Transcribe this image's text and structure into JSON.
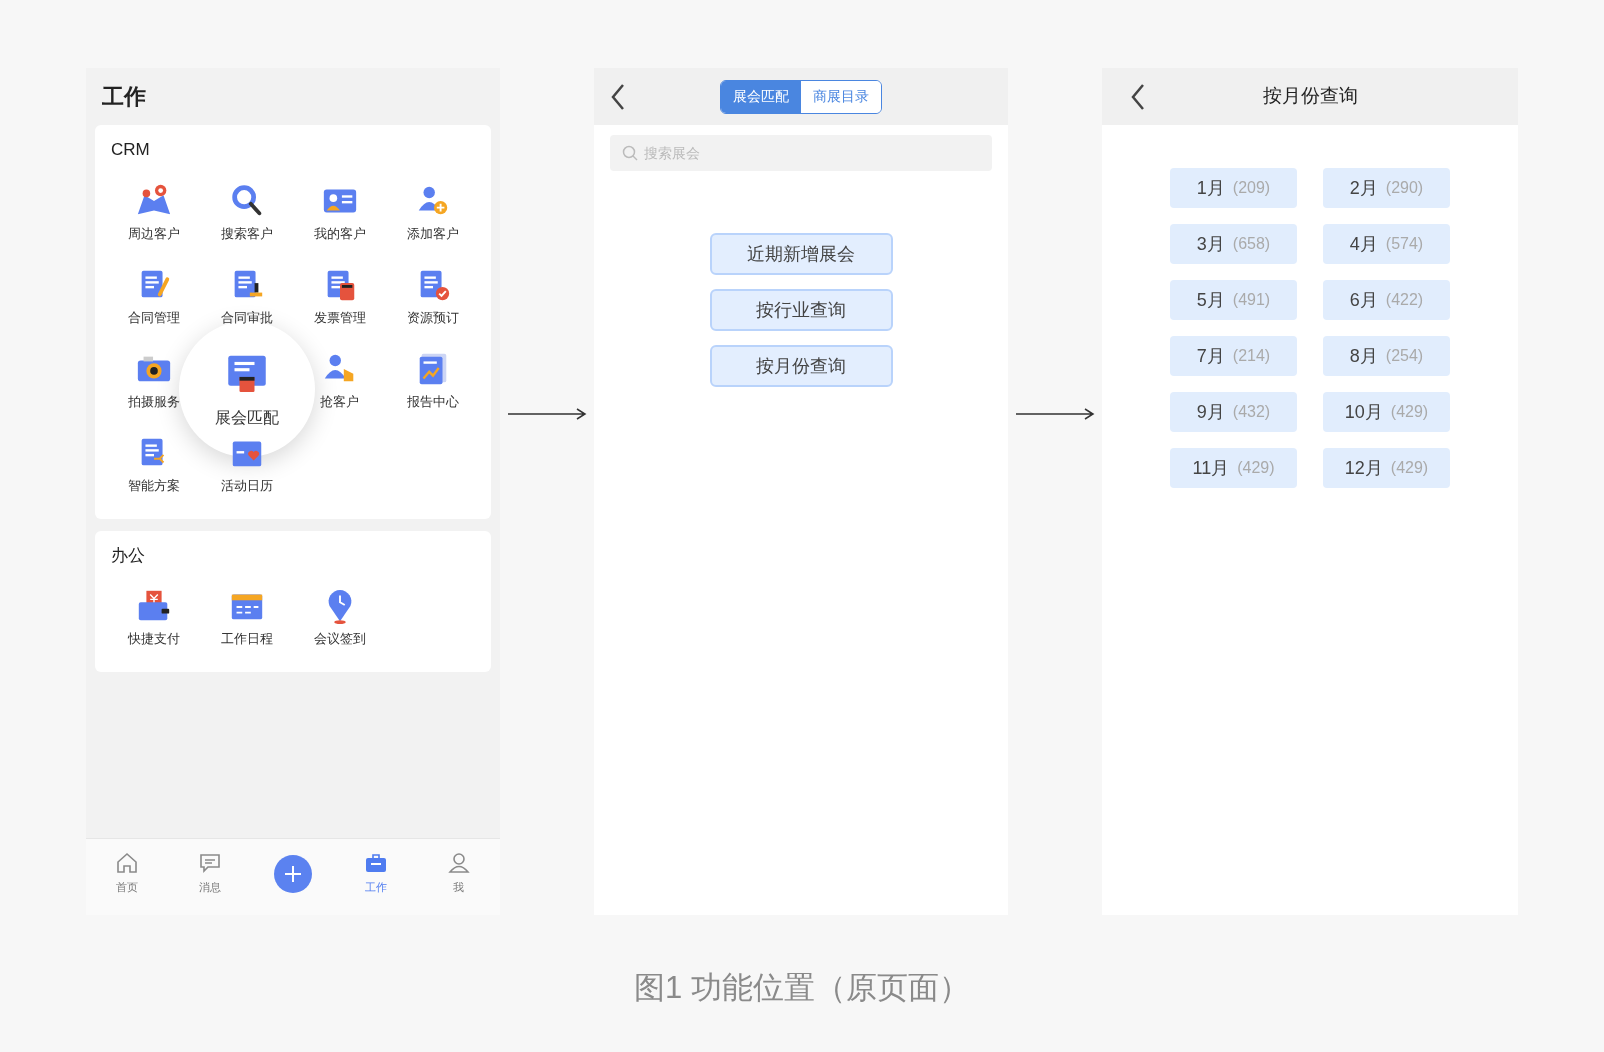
{
  "work_screen": {
    "title": "工作",
    "sections": [
      {
        "title": "CRM",
        "items": [
          {
            "label": "周边客户",
            "highlighted": false
          },
          {
            "label": "搜索客户",
            "highlighted": false
          },
          {
            "label": "我的客户",
            "highlighted": false
          },
          {
            "label": "添加客户",
            "highlighted": false
          },
          {
            "label": "合同管理",
            "highlighted": false
          },
          {
            "label": "合同审批",
            "highlighted": false
          },
          {
            "label": "发票管理",
            "highlighted": false
          },
          {
            "label": "资源预订",
            "highlighted": false
          },
          {
            "label": "拍摄服务",
            "highlighted": false
          },
          {
            "label": "展会匹配",
            "highlighted": true
          },
          {
            "label": "抢客户",
            "highlighted": false
          },
          {
            "label": "报告中心",
            "highlighted": false
          },
          {
            "label": "智能方案",
            "highlighted": false
          },
          {
            "label": "活动日历",
            "highlighted": false
          }
        ]
      },
      {
        "title": "办公",
        "items": [
          {
            "label": "快捷支付",
            "highlighted": false
          },
          {
            "label": "工作日程",
            "highlighted": false
          },
          {
            "label": "会议签到",
            "highlighted": false
          }
        ]
      }
    ],
    "bottom_nav": [
      {
        "kind": "tab",
        "label": "首页",
        "selected": false
      },
      {
        "kind": "tab",
        "label": "消息",
        "selected": false
      },
      {
        "kind": "add",
        "selected": false
      },
      {
        "kind": "tab",
        "label": "工作",
        "selected": true
      },
      {
        "kind": "tab",
        "label": "我",
        "selected": false
      }
    ]
  },
  "expo_screen": {
    "tabs": [
      {
        "label": "展会匹配",
        "selected": true
      },
      {
        "label": "商展目录",
        "selected": false
      }
    ],
    "search": {
      "placeholder": "搜索展会"
    },
    "buttons": [
      "近期新增展会",
      "按行业查询",
      "按月份查询"
    ]
  },
  "month_screen": {
    "title": "按月份查询",
    "months": [
      {
        "label": "1月",
        "count": "(209)"
      },
      {
        "label": "2月",
        "count": "(290)"
      },
      {
        "label": "3月",
        "count": "(658)"
      },
      {
        "label": "4月",
        "count": "(574)"
      },
      {
        "label": "5月",
        "count": "(491)"
      },
      {
        "label": "6月",
        "count": "(422)"
      },
      {
        "label": "7月",
        "count": "(214)"
      },
      {
        "label": "8月",
        "count": "(254)"
      },
      {
        "label": "9月",
        "count": "(432)"
      },
      {
        "label": "10月",
        "count": "(429)"
      },
      {
        "label": "11月",
        "count": "(429)"
      },
      {
        "label": "12月",
        "count": "(429)"
      }
    ]
  },
  "caption": "图1 功能位置（原页面）"
}
